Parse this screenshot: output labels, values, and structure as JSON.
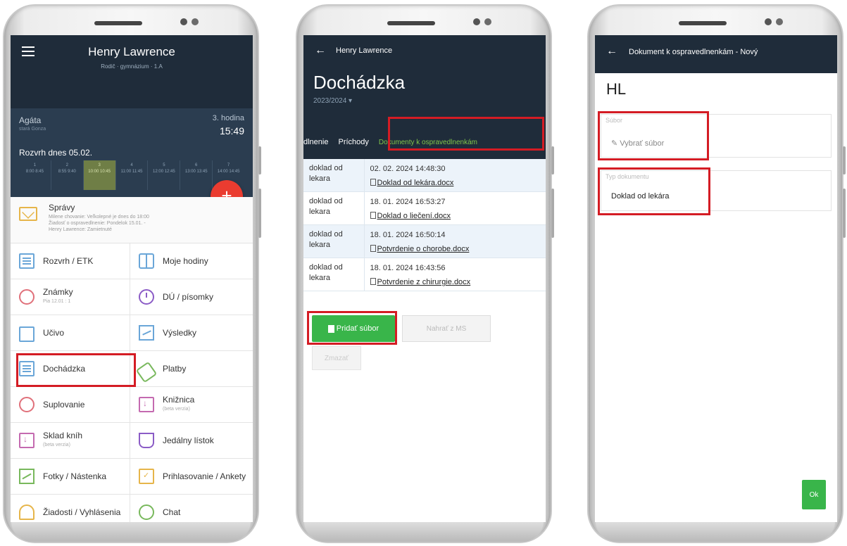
{
  "phone1": {
    "header": {
      "name": "Henry Lawrence",
      "subtitle": "Rodič · gymnázium · 1.A"
    },
    "info": {
      "user": "Agáta",
      "user_detail": "stará Gonza",
      "hour_label": "3. hodina",
      "time": "15:49",
      "timetable_title": "Rozvrh dnes 05.02.",
      "periods": [
        {
          "num": "1",
          "time": "8:00 8:45"
        },
        {
          "num": "2",
          "time": "8:55 9:40"
        },
        {
          "num": "3",
          "time": "10:00 10:45"
        },
        {
          "num": "4",
          "time": "11:00 11:45"
        },
        {
          "num": "5",
          "time": "12:00 12:45"
        },
        {
          "num": "6",
          "time": "13:00 13:45"
        },
        {
          "num": "7",
          "time": "14:00 14:45"
        }
      ]
    },
    "fab_label": "+",
    "messages": {
      "title": "Správy",
      "line1": "Milene chovanie: Veľkolepné je dnes do 18:00",
      "line2": "Žiadosť o ospravedlnenie: Pondelok 15.01. -",
      "line3": "Henry Lawrence: Zamietnuté"
    },
    "menu": [
      {
        "label": "Rozvrh / ETK",
        "sub": ""
      },
      {
        "label": "Moje hodiny",
        "sub": ""
      },
      {
        "label": "Známky",
        "sub": "Pia 12.01 : 1"
      },
      {
        "label": "DÚ / písomky",
        "sub": ""
      },
      {
        "label": "Učivo",
        "sub": ""
      },
      {
        "label": "Výsledky",
        "sub": ""
      },
      {
        "label": "Dochádzka",
        "sub": ""
      },
      {
        "label": "Platby",
        "sub": ""
      },
      {
        "label": "Suplovanie",
        "sub": ""
      },
      {
        "label": "Knižnica",
        "sub": "(beta verzia)"
      },
      {
        "label": "Sklad kníh",
        "sub": "(beta verzia)"
      },
      {
        "label": "Jedálny lístok",
        "sub": ""
      },
      {
        "label": "Fotky / Nástenka",
        "sub": ""
      },
      {
        "label": "Prihlasovanie / Ankety",
        "sub": ""
      },
      {
        "label": "Žiadosti / Vyhlásenia",
        "sub": ""
      },
      {
        "label": "Chat",
        "sub": ""
      }
    ]
  },
  "phone2": {
    "header": {
      "name": "Henry Lawrence",
      "title": "Dochádzka",
      "year": "2023/2024 ▾"
    },
    "tabs": [
      "dlnenie",
      "Príchody",
      "Dokumenty k ospravedlnenkám"
    ],
    "rows": [
      {
        "type": "doklad od lekara",
        "date": "02. 02. 2024 14:48:30",
        "file": "Doklad od lekára.docx"
      },
      {
        "type": "doklad od lekara",
        "date": "18. 01. 2024 16:53:27",
        "file": "Doklad o liečení.docx"
      },
      {
        "type": "doklad od lekara",
        "date": "18. 01. 2024 16:50:14",
        "file": "Potvrdenie o chorobe.docx"
      },
      {
        "type": "doklad od lekara",
        "date": "18. 01. 2024 16:43:56",
        "file": "Potvrdenie z chirurgie.docx"
      }
    ],
    "buttons": {
      "add": "Pridať súbor",
      "ms": "Nahrať z MS",
      "close": "Zmazať"
    }
  },
  "phone3": {
    "header": {
      "title": "Dokument k ospravedlnenkám - Nový"
    },
    "initials": "HL",
    "file_field": {
      "label": "Súbor",
      "value": "Vybrať súbor"
    },
    "type_field": {
      "label": "Typ dokumentu",
      "value": "Doklad od lekára"
    },
    "ok_label": "Ok"
  },
  "colors": {
    "header": "#1f2c3a",
    "accent_green": "#39b54a",
    "highlight_red": "#d41c24",
    "fab_red": "#ea3c30"
  }
}
